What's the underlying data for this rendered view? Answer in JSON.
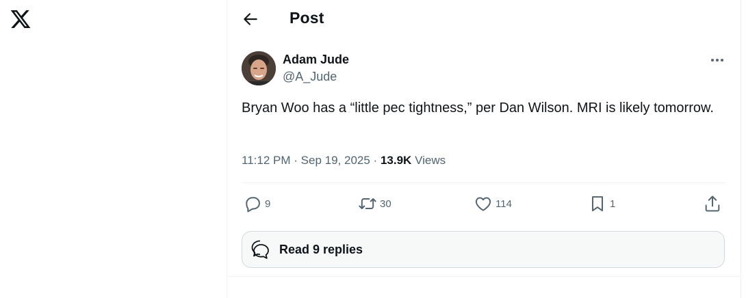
{
  "logo": {
    "icon": "x-logo-icon"
  },
  "header": {
    "title": "Post",
    "back_icon": "back-arrow-icon"
  },
  "tweet": {
    "author_name": "Adam Jude",
    "author_handle": "@A_Jude",
    "text": "Bryan Woo has a “little pec tightness,” per Dan Wilson. MRI is likely tomorrow.",
    "time": "11:12 PM",
    "separator": "·",
    "date": "Sep 19, 2025",
    "views_count": "13.9K",
    "views_label": "Views"
  },
  "actions": {
    "replies": "9",
    "reposts": "30",
    "likes": "114",
    "bookmarks": "1"
  },
  "read_replies": {
    "label": "Read 9 replies"
  },
  "colors": {
    "text_primary": "#0f1419",
    "text_secondary": "#536471",
    "border": "#eff3f4"
  }
}
